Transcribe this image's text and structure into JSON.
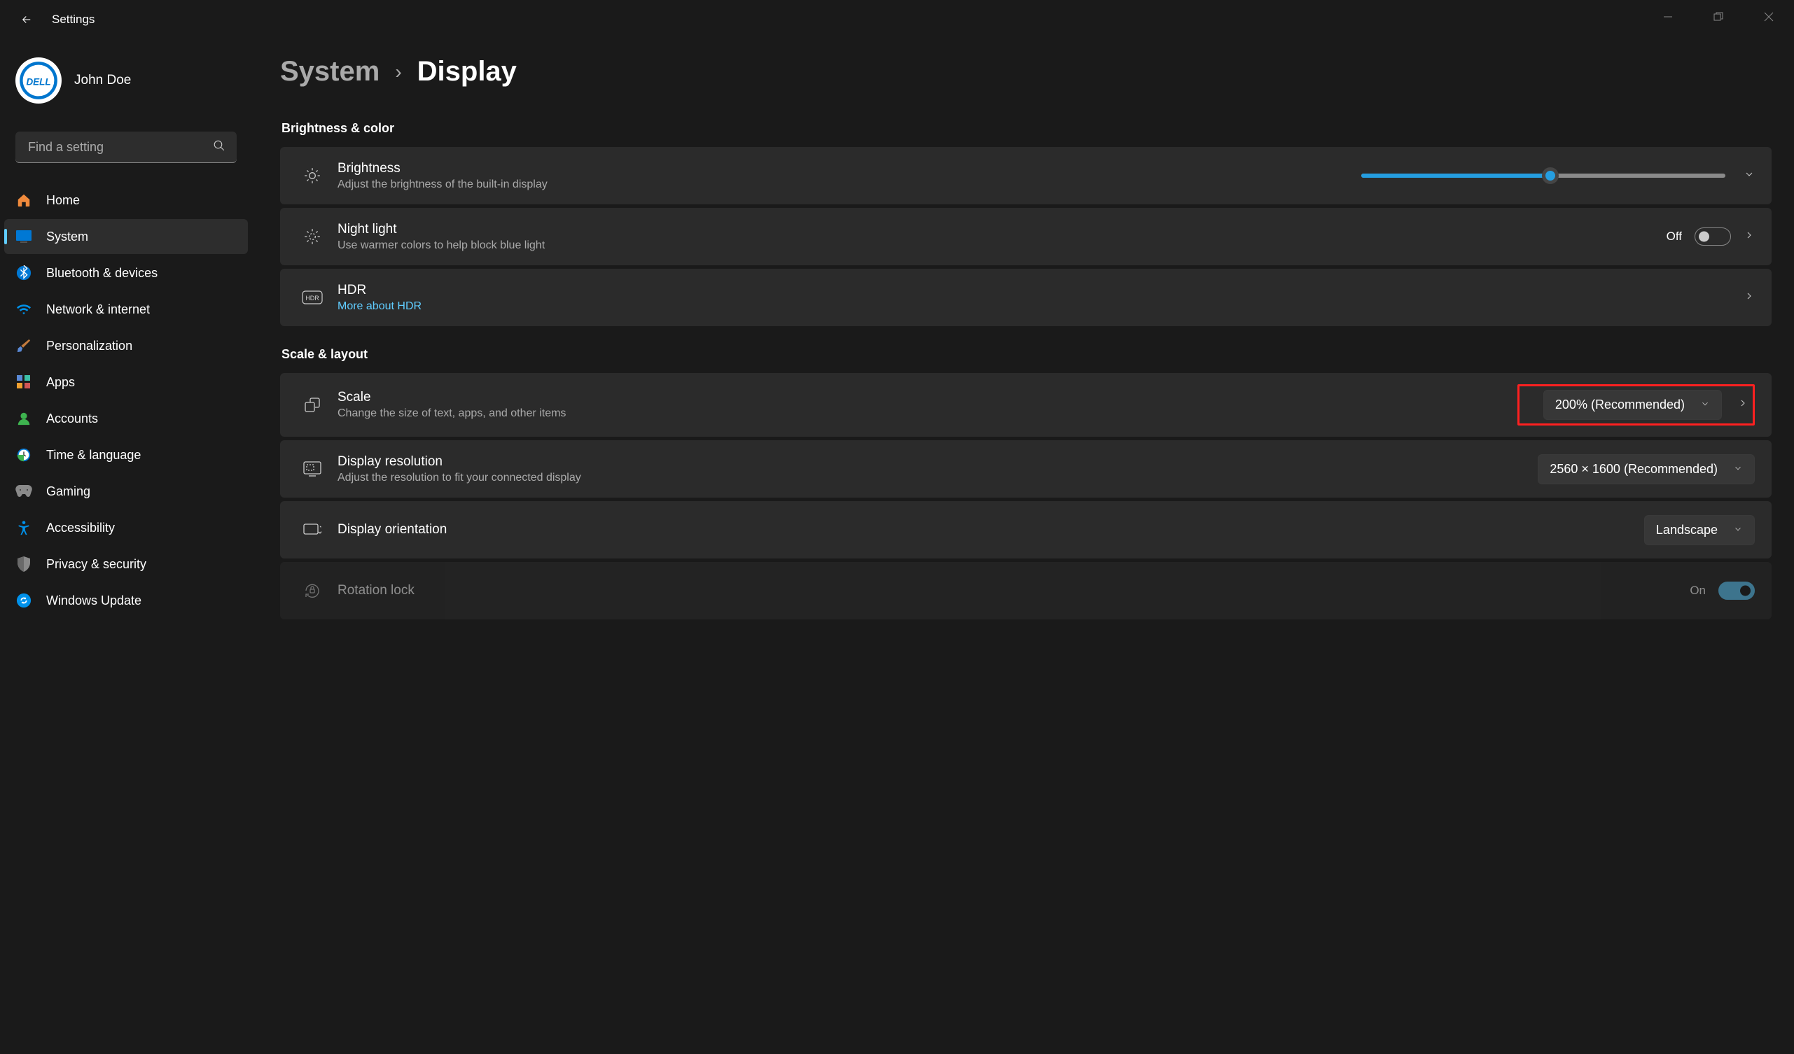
{
  "appTitle": "Settings",
  "profile": {
    "name": "John Doe",
    "brand": "DELL"
  },
  "search": {
    "placeholder": "Find a setting"
  },
  "nav": [
    {
      "label": "Home"
    },
    {
      "label": "System"
    },
    {
      "label": "Bluetooth & devices"
    },
    {
      "label": "Network & internet"
    },
    {
      "label": "Personalization"
    },
    {
      "label": "Apps"
    },
    {
      "label": "Accounts"
    },
    {
      "label": "Time & language"
    },
    {
      "label": "Gaming"
    },
    {
      "label": "Accessibility"
    },
    {
      "label": "Privacy & security"
    },
    {
      "label": "Windows Update"
    }
  ],
  "activeNav": "System",
  "breadcrumb": {
    "parent": "System",
    "current": "Display"
  },
  "sections": {
    "brightness_color": {
      "title": "Brightness & color",
      "brightness": {
        "title": "Brightness",
        "sub": "Adjust the brightness of the built-in display",
        "value": 52
      },
      "nightlight": {
        "title": "Night light",
        "sub": "Use warmer colors to help block blue light",
        "state": "Off"
      },
      "hdr": {
        "title": "HDR",
        "link": "More about HDR"
      }
    },
    "scale_layout": {
      "title": "Scale & layout",
      "scale": {
        "title": "Scale",
        "sub": "Change the size of text, apps, and other items",
        "value": "200% (Recommended)"
      },
      "resolution": {
        "title": "Display resolution",
        "sub": "Adjust the resolution to fit your connected display",
        "value": "2560 × 1600 (Recommended)"
      },
      "orientation": {
        "title": "Display orientation",
        "value": "Landscape"
      },
      "rotation": {
        "title": "Rotation lock",
        "state": "On"
      }
    }
  }
}
